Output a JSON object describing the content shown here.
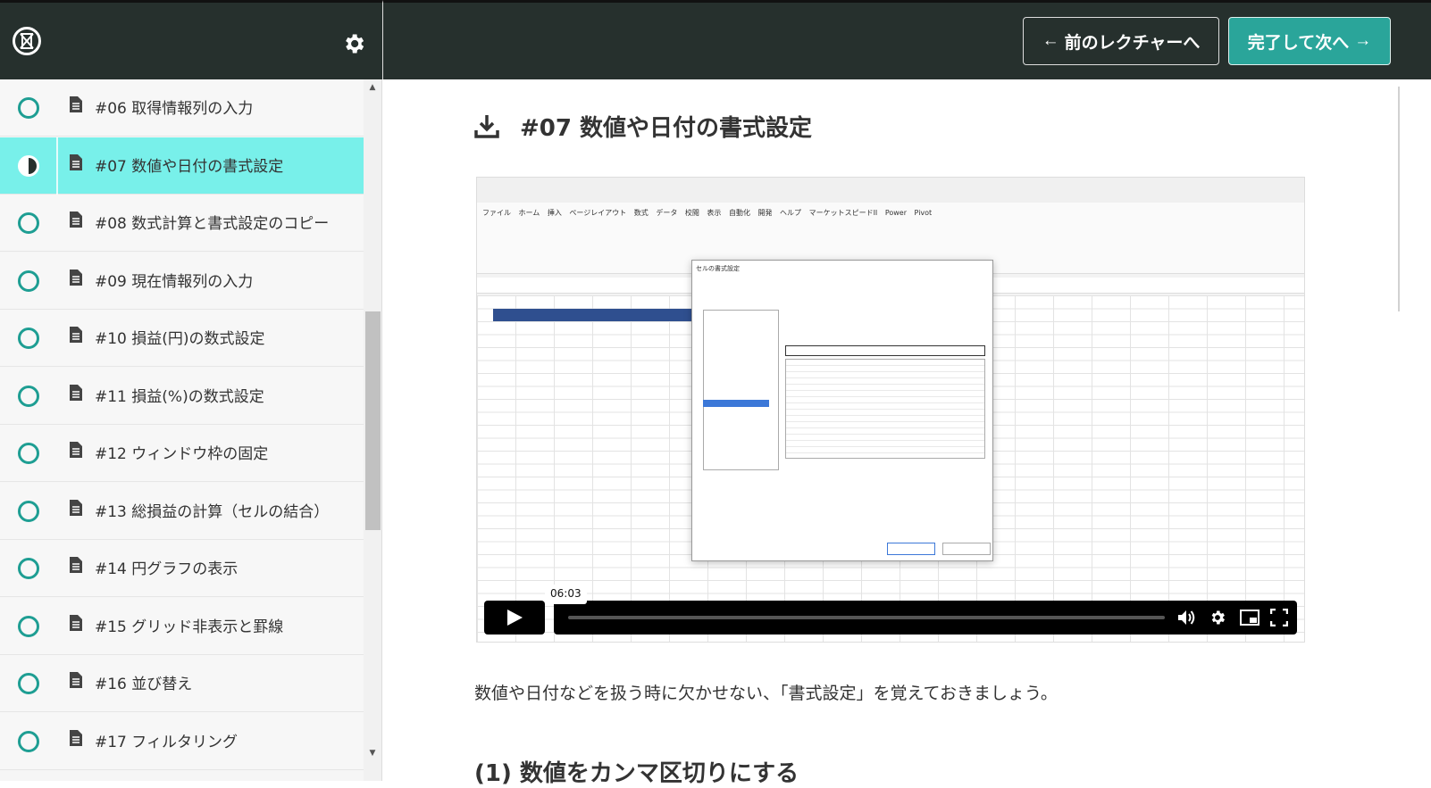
{
  "header": {
    "prev_label": "前のレクチャーへ",
    "next_label": "完了して次へ"
  },
  "sidebar": {
    "items": [
      {
        "label": "#06 取得情報列の入力",
        "state": "incomplete"
      },
      {
        "label": "#07 数値や日付の書式設定",
        "state": "in-progress"
      },
      {
        "label": "#08 数式計算と書式設定のコピー",
        "state": "incomplete"
      },
      {
        "label": "#09 現在情報列の入力",
        "state": "incomplete"
      },
      {
        "label": "#10 損益(円)の数式設定",
        "state": "incomplete"
      },
      {
        "label": "#11 損益(%)の数式設定",
        "state": "incomplete"
      },
      {
        "label": "#12 ウィンドウ枠の固定",
        "state": "incomplete"
      },
      {
        "label": "#13 総損益の計算（セルの結合）",
        "state": "incomplete"
      },
      {
        "label": "#14 円グラフの表示",
        "state": "incomplete"
      },
      {
        "label": "#15 グリッド非表示と罫線",
        "state": "incomplete"
      },
      {
        "label": "#16 並び替え",
        "state": "incomplete"
      },
      {
        "label": "#17 フィルタリング",
        "state": "incomplete"
      }
    ]
  },
  "lecture": {
    "title": "#07 数値や日付の書式設定",
    "description": "数値や日付などを扱う時に欠かせない、「書式設定」を覚えておきましょう。",
    "next_heading": "(1) 数値をカンマ区切りにする"
  },
  "video": {
    "hover_time": "06:03",
    "progress": 0.0,
    "excel_menu": "ファイル ホーム 挿入 ページレイアウト 数式 データ 校閲 表示 自動化 開発 ヘルプ マーケットスピードII Power Pivot",
    "dialog_title": "セルの書式設定"
  },
  "colors": {
    "header_bg": "#26302d",
    "accent": "#2aa59a",
    "active_row": "#78f0ea",
    "circle": "#1e9e93"
  }
}
